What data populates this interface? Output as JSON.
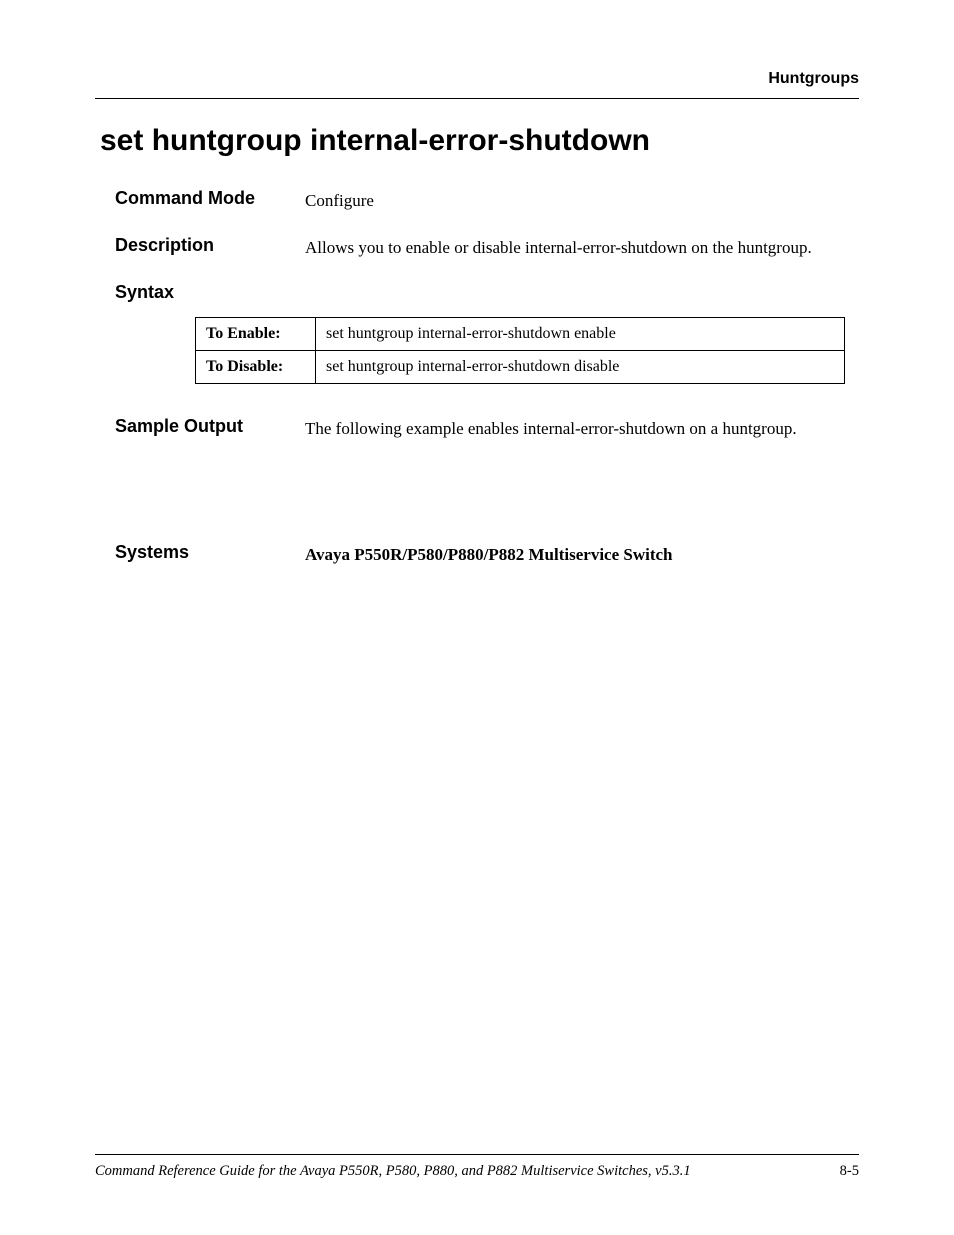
{
  "header": {
    "section_label": "Huntgroups"
  },
  "title": "set huntgroup internal-error-shutdown",
  "command_mode": {
    "label": "Command Mode",
    "value": "Configure"
  },
  "description": {
    "label": "Description",
    "value": "Allows you to enable or disable internal-error-shutdown on the huntgroup."
  },
  "syntax": {
    "label": "Syntax",
    "rows": [
      {
        "key": "To Enable:",
        "value": "set huntgroup internal-error-shutdown enable"
      },
      {
        "key": "To Disable:",
        "value": "set huntgroup internal-error-shutdown disable"
      }
    ]
  },
  "sample_output": {
    "label": "Sample Output",
    "value": "The following example enables internal-error-shutdown on a huntgroup."
  },
  "systems": {
    "label": "Systems",
    "value": "Avaya P550R/P580/P880/P882 Multiservice Switch"
  },
  "footer": {
    "guide": "Command Reference Guide for the Avaya P550R, P580, P880, and P882 Multiservice Switches, v5.3.1",
    "page": "8-5"
  }
}
